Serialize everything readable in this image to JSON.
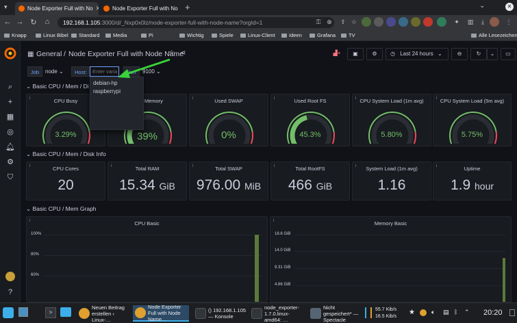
{
  "browser": {
    "tabs": [
      {
        "label": "Node Exporter Full with No",
        "active": true
      },
      {
        "label": "Node Exporter Full with No",
        "active": false
      }
    ],
    "new_tab": "+",
    "url_host": "192.168.1.105",
    "url_path": ":3000/d/_Nxp0x0lz/node-exporter-full-with-node-name?orgId=1",
    "bookmarks": [
      "Knapp",
      "Linux Bibel",
      "Standard",
      "Media",
      "Pi",
      "Wichtig",
      "Spiele",
      "Linux-Client",
      "Ideen",
      "Grafana",
      "TV"
    ],
    "all_bookmarks": "Alle Lesezeichen"
  },
  "grafana": {
    "breadcrumb_root": "General",
    "breadcrumb_sep": "/",
    "dashboard_title": "Node Exporter Full with Node Name",
    "time_picker": "Last 24 hours",
    "variables": {
      "job_label": "Job",
      "job_value": "node",
      "host_label": "Host:",
      "host_placeholder": "Enter varia",
      "port_label": "Port",
      "port_value": "9100"
    },
    "host_options": [
      "debian-hp",
      "raspberrypi"
    ],
    "rows": {
      "row1": "Basic CPU / Mem / Di",
      "row2": "Basic CPU / Mem / Disk Info",
      "row3": "Basic CPU / Mem Graph"
    },
    "gauges": [
      {
        "title": "CPU Busy",
        "value": "3.29%",
        "fraction": 0.033
      },
      {
        "title": "RAM Memory",
        "value": "39%",
        "fraction": 0.39
      },
      {
        "title": "Used SWAP",
        "value": "0%",
        "fraction": 0.0
      },
      {
        "title": "Used Root FS",
        "value": "45.3%",
        "fraction": 0.453
      },
      {
        "title": "CPU System Load (1m avg)",
        "value": "5.80%",
        "fraction": 0.058
      },
      {
        "title": "CPU System Load (5m avg)",
        "value": "5.75%",
        "fraction": 0.0575
      }
    ],
    "stats": [
      {
        "title": "CPU Cores",
        "value": "20",
        "unit": ""
      },
      {
        "title": "Total RAM",
        "value": "15.34",
        "unit": "GiB"
      },
      {
        "title": "Total SWAP",
        "value": "976.00",
        "unit": "MiB"
      },
      {
        "title": "Total RootFS",
        "value": "466",
        "unit": "GiB"
      },
      {
        "title": "System Load (1m avg)",
        "value": "1.16",
        "unit": ""
      },
      {
        "title": "Uptime",
        "value": "1.9",
        "unit": "hour"
      }
    ],
    "graphs": {
      "cpu_title": "CPU Basic",
      "cpu_ticks": [
        "100%",
        "80%",
        "60%"
      ],
      "mem_title": "Memory Basic",
      "mem_ticks": [
        "18.6 GiB",
        "14.0 GiB",
        "9.31 GiB",
        "4.66 GiB"
      ]
    },
    "colors": {
      "green": "#73bf69",
      "red": "#f2495c",
      "blue": "#6e9fff",
      "arrow": "#3ad13a"
    }
  },
  "taskbar": {
    "tasks": [
      {
        "label": "Neuen Beitrag erstellen ‹ Linux-…",
        "active": false
      },
      {
        "label": "Node Exporter Full with Node Name…",
        "active": true
      },
      {
        "label": "() 192.168.1.105 — Konsole",
        "active": false
      },
      {
        "label": "node_exporter-1.7.0.linux-amd64: …",
        "active": false
      },
      {
        "label": "Nicht gespeichert* — Spectacle",
        "active": false
      }
    ],
    "net_up": "55.7 Kib/s",
    "net_down": "16.5 Kib/s",
    "clock": "20:20"
  }
}
